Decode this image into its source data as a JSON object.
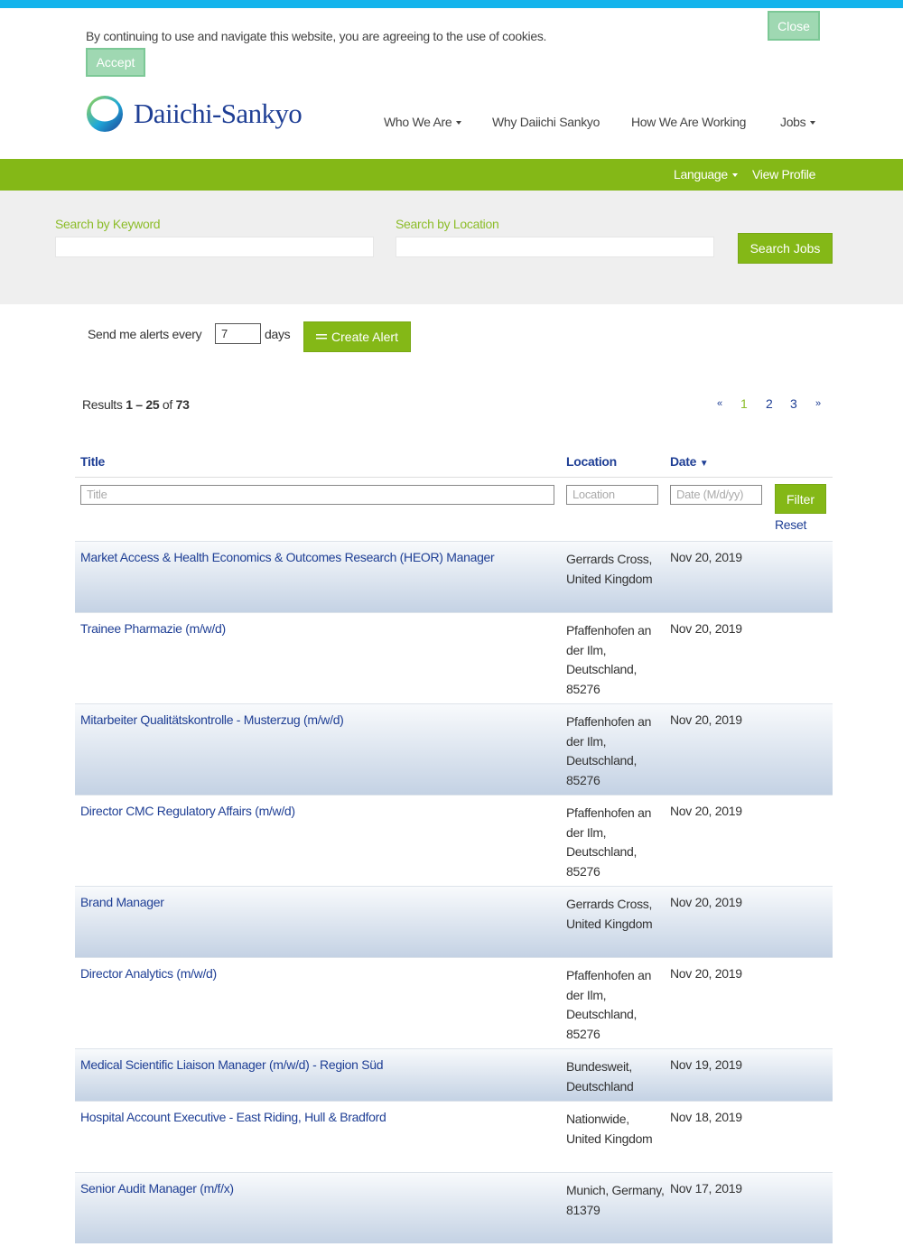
{
  "colors": {
    "accent_blue": "#14b4ec",
    "brand_green": "#84b817",
    "link_blue": "#1f3f95",
    "label_green": "#8dbd2a"
  },
  "cookie": {
    "message": "By continuing to use and navigate this website, you are agreeing to the use of cookies.",
    "accept_label": "Accept",
    "close_label": "Close"
  },
  "brand": {
    "name": "Daiichi-Sankyo",
    "logo_icon": "daiichi-sankyo-logo-icon"
  },
  "nav": {
    "who": "Who We Are",
    "why": "Why Daiichi Sankyo",
    "how": "How We Are Working",
    "jobs": "Jobs"
  },
  "greenbar": {
    "language": "Language",
    "profile": "View Profile"
  },
  "search": {
    "keyword_label": "Search by Keyword",
    "location_label": "Search by Location",
    "button": "Search Jobs"
  },
  "alert": {
    "prefix": "Send me alerts every",
    "days_value": "7",
    "suffix": "days",
    "button": "Create Alert",
    "button_icon": "list-icon"
  },
  "results": {
    "label": "Results",
    "range": "1 – 25",
    "of": "of",
    "total": "73"
  },
  "pager": {
    "prev": "«",
    "pages": [
      "1",
      "2",
      "3"
    ],
    "next": "»",
    "current": "1"
  },
  "table": {
    "headers": {
      "title": "Title",
      "location": "Location",
      "date": "Date"
    },
    "sort_indicator": "▼",
    "filter": {
      "title_placeholder": "Title",
      "location_placeholder": "Location",
      "date_placeholder": "Date (M/d/yy)",
      "button": "Filter",
      "reset": "Reset"
    },
    "rows": [
      {
        "title": "Market Access & Health Economics & Outcomes Research (HEOR) Manager",
        "location": "Gerrards Cross, United Kingdom",
        "date": "Nov 20, 2019"
      },
      {
        "title": "Trainee Pharmazie (m/w/d)",
        "location": "Pfaffenhofen an der Ilm, Deutschland, 85276",
        "date": "Nov 20, 2019"
      },
      {
        "title": "Mitarbeiter Qualitätskontrolle - Musterzug (m/w/d)",
        "location": "Pfaffenhofen an der Ilm, Deutschland, 85276",
        "date": "Nov 20, 2019"
      },
      {
        "title": "Director CMC Regulatory Affairs (m/w/d)",
        "location": "Pfaffenhofen an der Ilm, Deutschland, 85276",
        "date": "Nov 20, 2019"
      },
      {
        "title": "Brand Manager",
        "location": "Gerrards Cross, United Kingdom",
        "date": "Nov 20, 2019"
      },
      {
        "title": "Director Analytics (m/w/d)",
        "location": "Pfaffenhofen an der Ilm, Deutschland, 85276",
        "date": "Nov 20, 2019"
      },
      {
        "title": "Medical Scientific Liaison Manager (m/w/d) - Region Süd",
        "location": "Bundesweit, Deutschland",
        "date": "Nov 19, 2019"
      },
      {
        "title": "Hospital Account Executive - East Riding, Hull & Bradford",
        "location": "Nationwide, United Kingdom",
        "date": "Nov 18, 2019"
      },
      {
        "title": "Senior Audit Manager (m/f/x)",
        "location": "Munich, Germany, 81379",
        "date": "Nov 17, 2019"
      }
    ]
  }
}
